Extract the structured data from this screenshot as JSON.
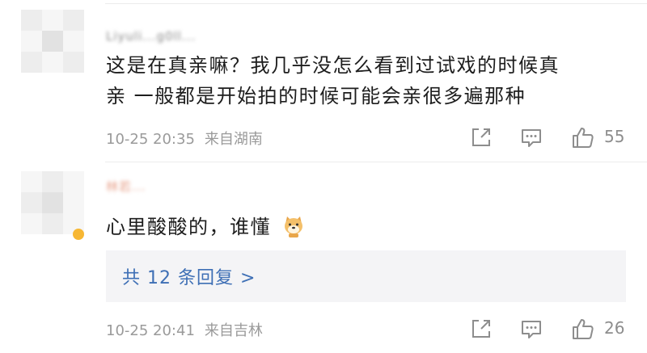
{
  "comments": [
    {
      "username": "Liyuli...g0ll...",
      "text_line1": "这是在真亲嘛？我几乎没怎么看到过试戏的时候真",
      "text_line2": "亲 一般都是开始拍的时候可能会亲很多遍那种",
      "time": "10-25 20:35",
      "location": "来自湖南",
      "likes": "55"
    },
    {
      "username": "林若...",
      "text": "心里酸酸的，谁懂",
      "emoji": "doge-dog-emoji",
      "replies_label": "共 12 条回复 >",
      "time": "10-25 20:41",
      "location": "来自吉林",
      "likes": "26"
    }
  ],
  "icons": [
    "share-icon",
    "comment-icon",
    "like-icon"
  ],
  "colors": {
    "link": "#3e6fb5",
    "meta": "#9a9a9a",
    "badge": "#f7b733"
  }
}
